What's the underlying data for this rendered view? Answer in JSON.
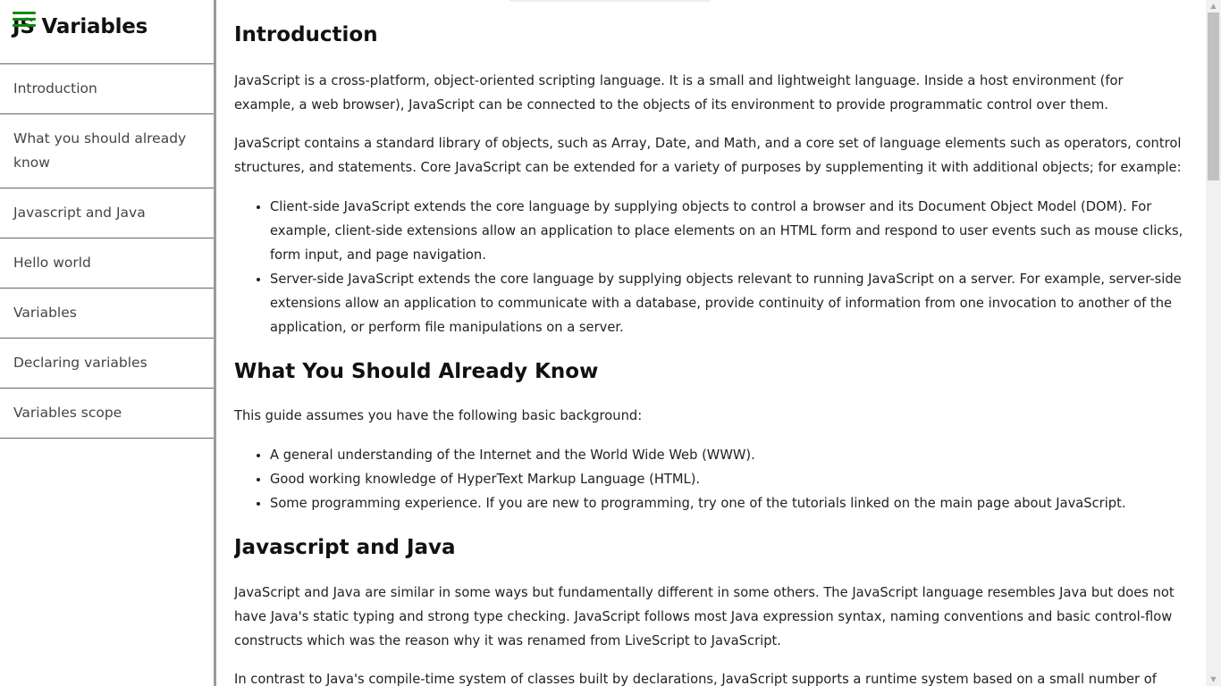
{
  "sidebar": {
    "title": "JS Variables",
    "items": [
      {
        "label": "Introduction"
      },
      {
        "label": "What you should already know"
      },
      {
        "label": "Javascript and Java"
      },
      {
        "label": "Hello world"
      },
      {
        "label": "Variables"
      },
      {
        "label": "Declaring variables"
      },
      {
        "label": "Variables scope"
      }
    ]
  },
  "main": {
    "introduction": {
      "heading": "Introduction",
      "p1": "JavaScript is a cross-platform, object-oriented scripting language. It is a small and lightweight language. Inside a host environment (for example, a web browser), JavaScript can be connected to the objects of its environment to provide programmatic control over them.",
      "p2": "JavaScript contains a standard library of objects, such as Array, Date, and Math, and a core set of language elements such as operators, control structures, and statements. Core JavaScript can be extended for a variety of purposes by supplementing it with additional objects; for example:",
      "list": [
        "Client-side JavaScript extends the core language by supplying objects to control a browser and its Document Object Model (DOM). For example, client-side extensions allow an application to place elements on an HTML form and respond to user events such as mouse clicks, form input, and page navigation.",
        "Server-side JavaScript extends the core language by supplying objects relevant to running JavaScript on a server. For example, server-side extensions allow an application to communicate with a database, provide continuity of information from one invocation to another of the application, or perform file manipulations on a server."
      ]
    },
    "know": {
      "heading": "What You Should Already Know",
      "p1": "This guide assumes you have the following basic background:",
      "list": [
        "A general understanding of the Internet and the World Wide Web (WWW).",
        "Good working knowledge of HyperText Markup Language (HTML).",
        "Some programming experience. If you are new to programming, try one of the tutorials linked on the main page about JavaScript."
      ]
    },
    "java": {
      "heading": "Javascript and Java",
      "p1": "JavaScript and Java are similar in some ways but fundamentally different in some others. The JavaScript language resembles Java but does not have Java's static typing and strong type checking. JavaScript follows most Java expression syntax, naming conventions and basic control-flow constructs which was the reason why it was renamed from LiveScript to JavaScript.",
      "p2": "In contrast to Java's compile-time system of classes built by declarations, JavaScript supports a runtime system based on a small number of data"
    }
  },
  "colors": {
    "hamburger": "#118a11",
    "sidebar_border": "#9a9a9a",
    "scrollbar_thumb": "#c1c1c1"
  },
  "icons": {
    "menu": "hamburger-menu-icon",
    "scroll_up": "scroll-up-arrow-icon",
    "scroll_down": "scroll-down-arrow-icon"
  }
}
